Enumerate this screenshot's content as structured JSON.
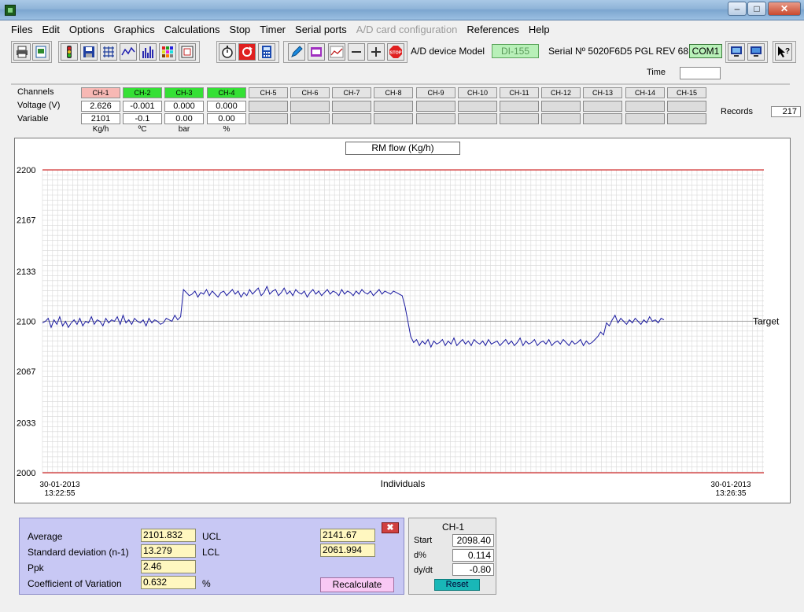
{
  "menu": [
    "Files",
    "Edit",
    "Options",
    "Graphics",
    "Calculations",
    "Stop",
    "Timer",
    "Serial ports",
    "A/D card configuration",
    "References",
    "Help"
  ],
  "menu_disabled": [
    "A/D card configuration"
  ],
  "toolbar": {
    "device_label": "A/D device Model",
    "device_model": "DI-155",
    "serial": "Serial Nº 5020F6D5   PGL   REV 68",
    "com_port": "COM1",
    "time_label": "Time",
    "time_value": ""
  },
  "channels": {
    "row_labels": {
      "channels": "Channels",
      "voltage": "Voltage (V)",
      "variable": "Variable"
    },
    "items": [
      {
        "name": "CH-1",
        "state": "red",
        "voltage": "2.626",
        "variable": "2101",
        "unit": "Kg/h"
      },
      {
        "name": "CH-2",
        "state": "green",
        "voltage": "-0.001",
        "variable": "-0.1",
        "unit": "ºC"
      },
      {
        "name": "CH-3",
        "state": "green",
        "voltage": "0.000",
        "variable": "0.00",
        "unit": "bar"
      },
      {
        "name": "CH-4",
        "state": "green",
        "voltage": "0.000",
        "variable": "0.00",
        "unit": "%"
      },
      {
        "name": "CH-5",
        "state": "off",
        "voltage": "",
        "variable": "",
        "unit": ""
      },
      {
        "name": "CH-6",
        "state": "off",
        "voltage": "",
        "variable": "",
        "unit": ""
      },
      {
        "name": "CH-7",
        "state": "off",
        "voltage": "",
        "variable": "",
        "unit": ""
      },
      {
        "name": "CH-8",
        "state": "off",
        "voltage": "",
        "variable": "",
        "unit": ""
      },
      {
        "name": "CH-9",
        "state": "off",
        "voltage": "",
        "variable": "",
        "unit": ""
      },
      {
        "name": "CH-10",
        "state": "off",
        "voltage": "",
        "variable": "",
        "unit": ""
      },
      {
        "name": "CH-11",
        "state": "off",
        "voltage": "",
        "variable": "",
        "unit": ""
      },
      {
        "name": "CH-12",
        "state": "off",
        "voltage": "",
        "variable": "",
        "unit": ""
      },
      {
        "name": "CH-13",
        "state": "off",
        "voltage": "",
        "variable": "",
        "unit": ""
      },
      {
        "name": "CH-14",
        "state": "off",
        "voltage": "",
        "variable": "",
        "unit": ""
      },
      {
        "name": "CH-15",
        "state": "off",
        "voltage": "",
        "variable": "",
        "unit": ""
      }
    ],
    "records_label": "Records",
    "records_value": "217"
  },
  "chart_data": {
    "type": "line",
    "title": "RM flow (Kg/h)",
    "xlabel": "Individuals",
    "ylabel": "",
    "ylim": [
      2000,
      2200
    ],
    "yticks": [
      2000,
      2033,
      2067,
      2100,
      2133,
      2167,
      2200
    ],
    "x_start_label": [
      "30-01-2013",
      "13:22:55"
    ],
    "x_end_label": [
      "30-01-2013",
      "13:26:35"
    ],
    "target_label": "Target",
    "target_value": 2100,
    "upper_limit": 2200,
    "lower_limit": 2000,
    "grid": true,
    "colors": {
      "series": "#1a1aa0",
      "limits": "#d03030",
      "target": "#999999",
      "grid": "#d8d8d8"
    },
    "series": [
      {
        "values": [
          2099,
          2100,
          2102,
          2096,
          2101,
          2098,
          2103,
          2097,
          2100,
          2096,
          2099,
          2101,
          2098,
          2102,
          2097,
          2100,
          2099,
          2103,
          2098,
          2101,
          2100,
          2097,
          2102,
          2099,
          2101,
          2100,
          2103,
          2098,
          2104,
          2099,
          2101,
          2098,
          2102,
          2100,
          2099,
          2101,
          2097,
          2102,
          2099,
          2101,
          2100,
          2098,
          2099,
          2102,
          2101,
          2100,
          2104,
          2101,
          2103,
          2121,
          2119,
          2117,
          2118,
          2120,
          2116,
          2119,
          2118,
          2121,
          2117,
          2120,
          2118,
          2116,
          2119,
          2120,
          2117,
          2119,
          2121,
          2118,
          2120,
          2116,
          2119,
          2117,
          2121,
          2118,
          2120,
          2122,
          2117,
          2119,
          2123,
          2118,
          2120,
          2121,
          2117,
          2119,
          2122,
          2118,
          2120,
          2117,
          2121,
          2119,
          2118,
          2120,
          2116,
          2119,
          2121,
          2118,
          2120,
          2117,
          2119,
          2121,
          2118,
          2120,
          2119,
          2117,
          2121,
          2118,
          2120,
          2119,
          2117,
          2120,
          2118,
          2121,
          2119,
          2118,
          2120,
          2117,
          2119,
          2121,
          2118,
          2120,
          2119,
          2118,
          2120,
          2119,
          2118,
          2117,
          2110,
          2100,
          2090,
          2086,
          2088,
          2084,
          2087,
          2085,
          2088,
          2083,
          2087,
          2085,
          2086,
          2088,
          2084,
          2087,
          2085,
          2089,
          2084,
          2086,
          2088,
          2085,
          2087,
          2084,
          2088,
          2086,
          2085,
          2087,
          2084,
          2088,
          2085,
          2086,
          2087,
          2084,
          2086,
          2088,
          2085,
          2087,
          2084,
          2086,
          2089,
          2084,
          2087,
          2085,
          2086,
          2088,
          2084,
          2086,
          2087,
          2085,
          2088,
          2084,
          2086,
          2087,
          2085,
          2088,
          2086,
          2084,
          2087,
          2085,
          2086,
          2088,
          2084,
          2087,
          2085,
          2086,
          2088,
          2090,
          2093,
          2091,
          2099,
          2097,
          2101,
          2104,
          2099,
          2102,
          2100,
          2098,
          2101,
          2099,
          2102,
          2100,
          2098,
          2101,
          2099,
          2103,
          2100,
          2101,
          2099,
          2102,
          2101
        ]
      }
    ]
  },
  "stats": {
    "average_label": "Average",
    "average": "2101.832",
    "std_label": "Standard deviation (n-1)",
    "std": "13.279",
    "ppk_label": "Ppk",
    "ppk": "2.46",
    "cv_label": "Coefficient of Variation",
    "cv": "0.632",
    "cv_unit": "%",
    "ucl_label": "UCL",
    "ucl": "2141.67",
    "lcl_label": "LCL",
    "lcl": "2061.994",
    "recalc_label": "Recalculate"
  },
  "channel_panel": {
    "title": "CH-1",
    "start_label": "Start",
    "start": "2098.40",
    "dpct_label": "d%",
    "dpct": "0.114",
    "dydt_label": "dy/dt",
    "dydt": "-0.80",
    "reset_label": "Reset"
  }
}
